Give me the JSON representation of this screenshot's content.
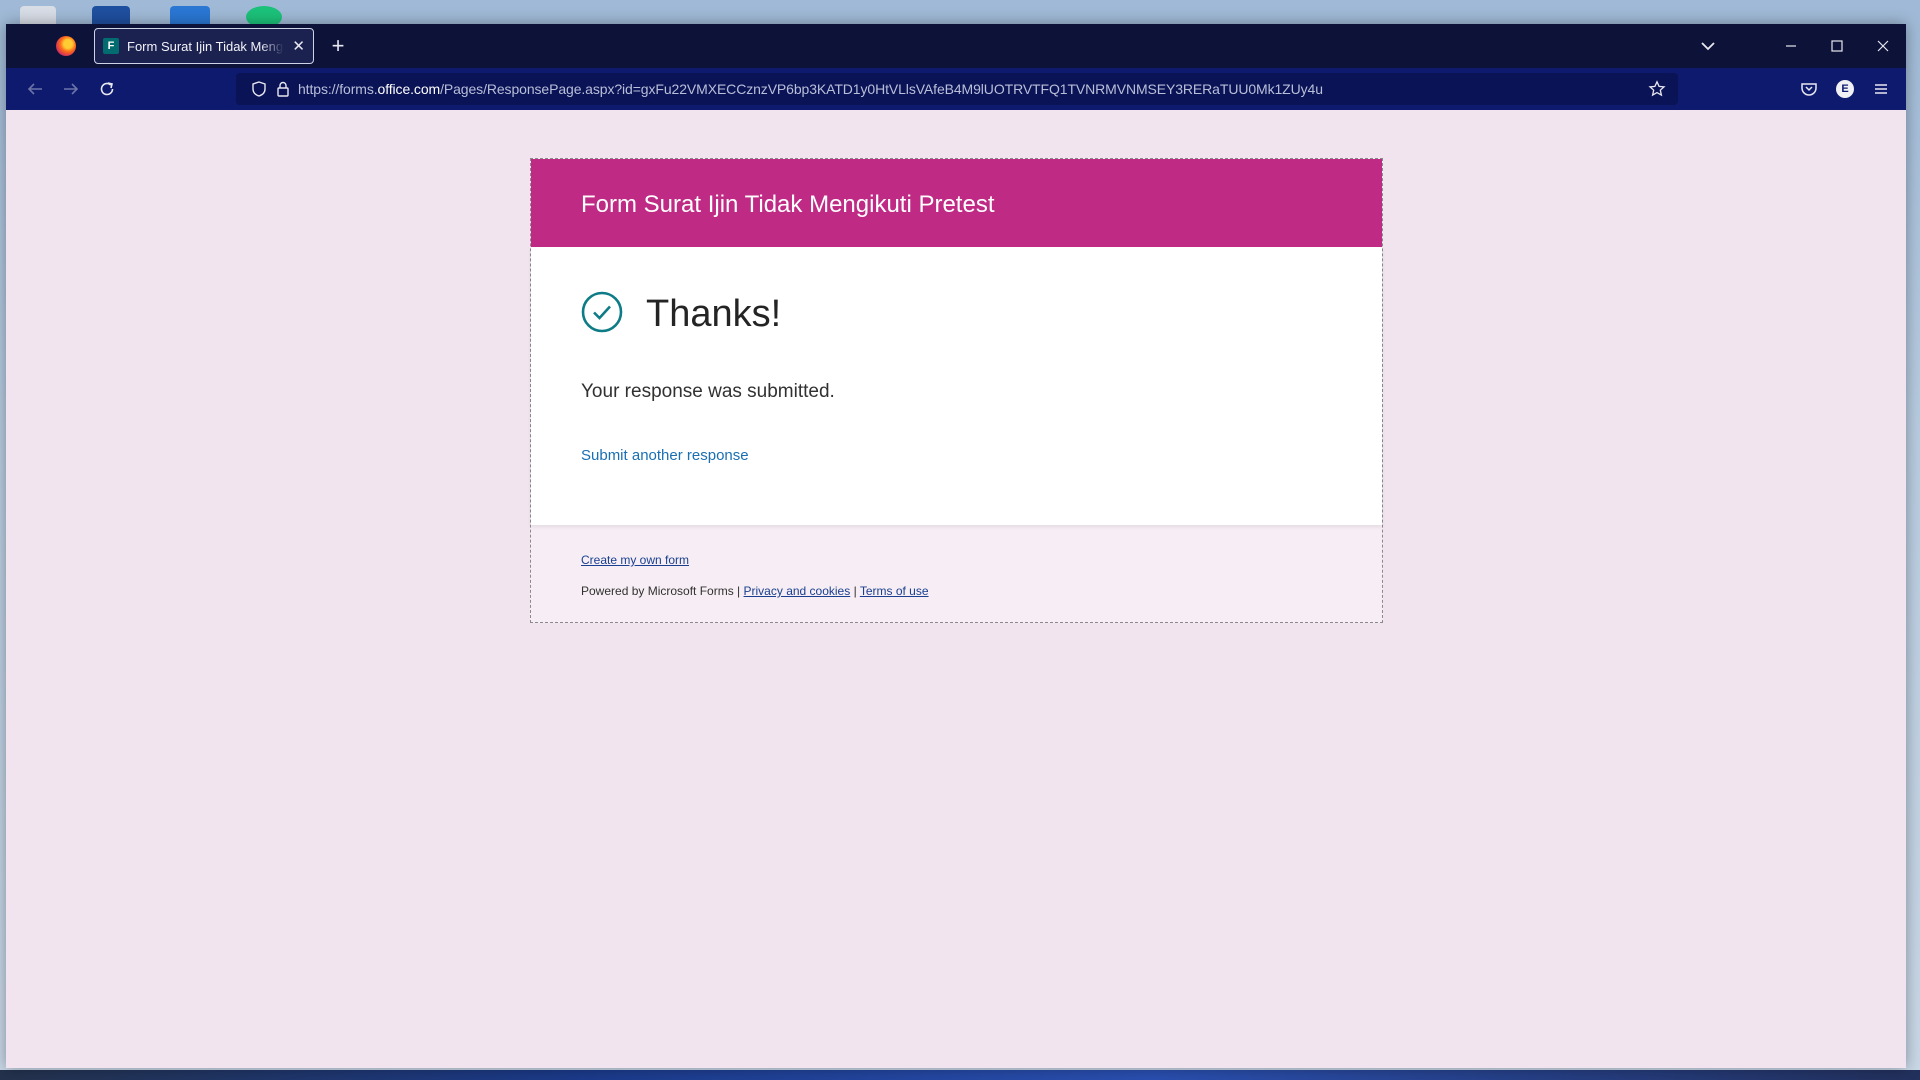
{
  "browser": {
    "tab": {
      "title": "Form Surat Ijin Tidak Mengikuti Pretest",
      "favicon_letter": "F"
    },
    "url": {
      "prefix": "https://forms.",
      "host": "office.com",
      "path": "/Pages/ResponsePage.aspx?id=gxFu22VMXECCznzVP6bp3KATD1y0HtVLlsVAfeB4M9lUOTRVTFQ1TVNRMVNMSEY3RERaTUU0Mk1ZUy4u"
    },
    "account_initial": "E",
    "icons": [
      "firefox-logo",
      "close-icon",
      "plus-icon",
      "chevron-down-icon",
      "minimize-icon",
      "maximize-icon",
      "window-close-icon",
      "back-arrow-icon",
      "forward-arrow-icon",
      "reload-icon",
      "shield-icon",
      "lock-icon",
      "star-icon",
      "pocket-icon",
      "account-icon",
      "menu-icon",
      "check-circle-icon"
    ]
  },
  "form": {
    "title": "Form Surat Ijin Tidak Mengikuti Pretest",
    "thanks": "Thanks!",
    "submitted_message": "Your response was submitted.",
    "submit_another": "Submit another response",
    "accent_color": "#bf2a85"
  },
  "footer": {
    "create_form": "Create my own form",
    "powered_by": "Powered by Microsoft Forms |",
    "privacy": "Privacy and cookies",
    "separator": "|",
    "terms": "Terms of use"
  }
}
